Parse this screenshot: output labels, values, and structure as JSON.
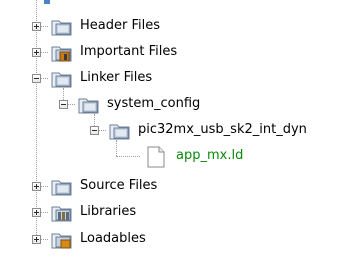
{
  "tree": {
    "items": [
      {
        "label": "Header Files",
        "icon": "logical-folder-icon",
        "state": "collapsed"
      },
      {
        "label": "Important Files",
        "icon": "important-files-folder-icon",
        "state": "collapsed"
      },
      {
        "label": "Linker Files",
        "icon": "logical-folder-icon",
        "state": "expanded",
        "children": [
          {
            "label": "system_config",
            "icon": "logical-folder-icon",
            "state": "expanded",
            "children": [
              {
                "label": "pic32mx_usb_sk2_int_dyn",
                "icon": "logical-folder-icon",
                "state": "expanded",
                "children": [
                  {
                    "label": "app_mx.ld",
                    "icon": "file-icon",
                    "color": "#0a8a0a"
                  }
                ]
              }
            ]
          }
        ]
      },
      {
        "label": "Source Files",
        "icon": "logical-folder-icon",
        "state": "collapsed"
      },
      {
        "label": "Libraries",
        "icon": "libraries-folder-icon",
        "state": "collapsed"
      },
      {
        "label": "Loadables",
        "icon": "loadables-folder-icon",
        "state": "collapsed"
      }
    ]
  }
}
